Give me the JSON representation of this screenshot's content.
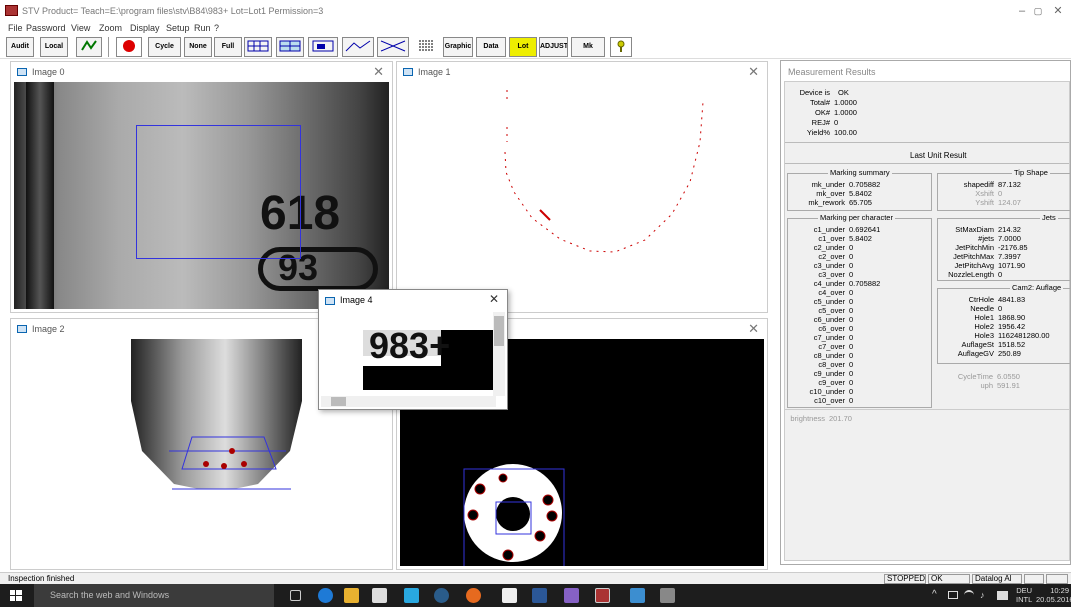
{
  "window": {
    "title": "STV  Product=  Teach=E:\\program files\\stv\\B84\\983+  Lot=Lot1  Permission=3",
    "min": "–",
    "max": "▢",
    "close": "✕"
  },
  "menu": [
    "File",
    "Password",
    "View",
    "Zoom",
    "Display",
    "Setup",
    "Run",
    "?"
  ],
  "toolbar": {
    "audit": "Audit",
    "local": "Local",
    "cycle": "Cycle",
    "none": "None",
    "full": "Full",
    "graphic": "Graphic",
    "data": "Data",
    "lot": "Lot",
    "adjust": "ADJUST",
    "mk_adjust": "Mk adjust"
  },
  "panels": {
    "image0": "Image 0",
    "image1": "Image 1",
    "image2": "Image 2",
    "image4": "Image 4",
    "close": "✕"
  },
  "image_text": {
    "label_a": "618",
    "label_b": "93",
    "popup_text": "983+"
  },
  "measurement": {
    "title": "Measurement Results",
    "summary": [
      {
        "k": "Device is",
        "v": "OK"
      },
      {
        "k": "Total#",
        "v": "1.0000"
      },
      {
        "k": "OK#",
        "v": "1.0000"
      },
      {
        "k": "REJ#",
        "v": "0"
      },
      {
        "k": "Yield%",
        "v": "100.00"
      }
    ],
    "last_unit": "Last Unit Result",
    "marking_summary": {
      "title": "Marking summary",
      "rows": [
        {
          "k": "mk_under",
          "v": "0.705882"
        },
        {
          "k": "mk_over",
          "v": "5.8402"
        },
        {
          "k": "mk_rework",
          "v": "65.705"
        }
      ]
    },
    "tip_shape": {
      "title": "Tip Shape",
      "rows": [
        {
          "k": "shapediff",
          "v": "87.132"
        },
        {
          "k": "Xshift",
          "v": "0"
        },
        {
          "k": "Yshift",
          "v": "124.07"
        }
      ]
    },
    "marking_per_char": {
      "title": "Marking per character",
      "rows": [
        {
          "k": "c1_under",
          "v": "0.692641"
        },
        {
          "k": "c1_over",
          "v": "5.8402"
        },
        {
          "k": "c2_under",
          "v": "0"
        },
        {
          "k": "c2_over",
          "v": "0"
        },
        {
          "k": "c3_under",
          "v": "0"
        },
        {
          "k": "c3_over",
          "v": "0"
        },
        {
          "k": "c4_under",
          "v": "0.705882"
        },
        {
          "k": "c4_over",
          "v": "0"
        },
        {
          "k": "c5_under",
          "v": "0"
        },
        {
          "k": "c5_over",
          "v": "0"
        },
        {
          "k": "c6_under",
          "v": "0"
        },
        {
          "k": "c6_over",
          "v": "0"
        },
        {
          "k": "c7_under",
          "v": "0"
        },
        {
          "k": "c7_over",
          "v": "0"
        },
        {
          "k": "c8_under",
          "v": "0"
        },
        {
          "k": "c8_over",
          "v": "0"
        },
        {
          "k": "c9_under",
          "v": "0"
        },
        {
          "k": "c9_over",
          "v": "0"
        },
        {
          "k": "c10_under",
          "v": "0"
        },
        {
          "k": "c10_over",
          "v": "0"
        }
      ]
    },
    "jets": {
      "title": "Jets",
      "rows": [
        {
          "k": "StMaxDiam",
          "v": "214.32"
        },
        {
          "k": "#jets",
          "v": "7.0000"
        },
        {
          "k": "JetPitchMin",
          "v": "-2176.85"
        },
        {
          "k": "JetPitchMax",
          "v": "7.3997"
        },
        {
          "k": "JetPitchAvg",
          "v": "1071.90"
        },
        {
          "k": "NozzleLength",
          "v": "0"
        }
      ]
    },
    "cam2": {
      "title": "Cam2: Auflage",
      "rows": [
        {
          "k": "CtrHole",
          "v": "4841.83"
        },
        {
          "k": "Needle",
          "v": "0"
        },
        {
          "k": "Hole1",
          "v": "1868.90"
        },
        {
          "k": "Hole2",
          "v": "1956.42"
        },
        {
          "k": "Hole3",
          "v": "1162481280.00"
        },
        {
          "k": "AuflageSt",
          "v": "1518.52"
        },
        {
          "k": "AuflageGV",
          "v": "250.89"
        }
      ]
    },
    "cycle": [
      {
        "k": "CycleTime",
        "v": "6.0550"
      },
      {
        "k": "uph",
        "v": "591.91"
      }
    ],
    "brightness": {
      "k": "brightness",
      "v": "201.70"
    }
  },
  "status": {
    "text": "Inspection finished",
    "stopped": "STOPPED",
    "ok": "OK",
    "datalog": "Datalog Al"
  },
  "taskbar": {
    "search": "Search the web and Windows",
    "lang1": "DEU",
    "lang2": "INTL",
    "time": "10:29",
    "date": "20.05.2016"
  }
}
